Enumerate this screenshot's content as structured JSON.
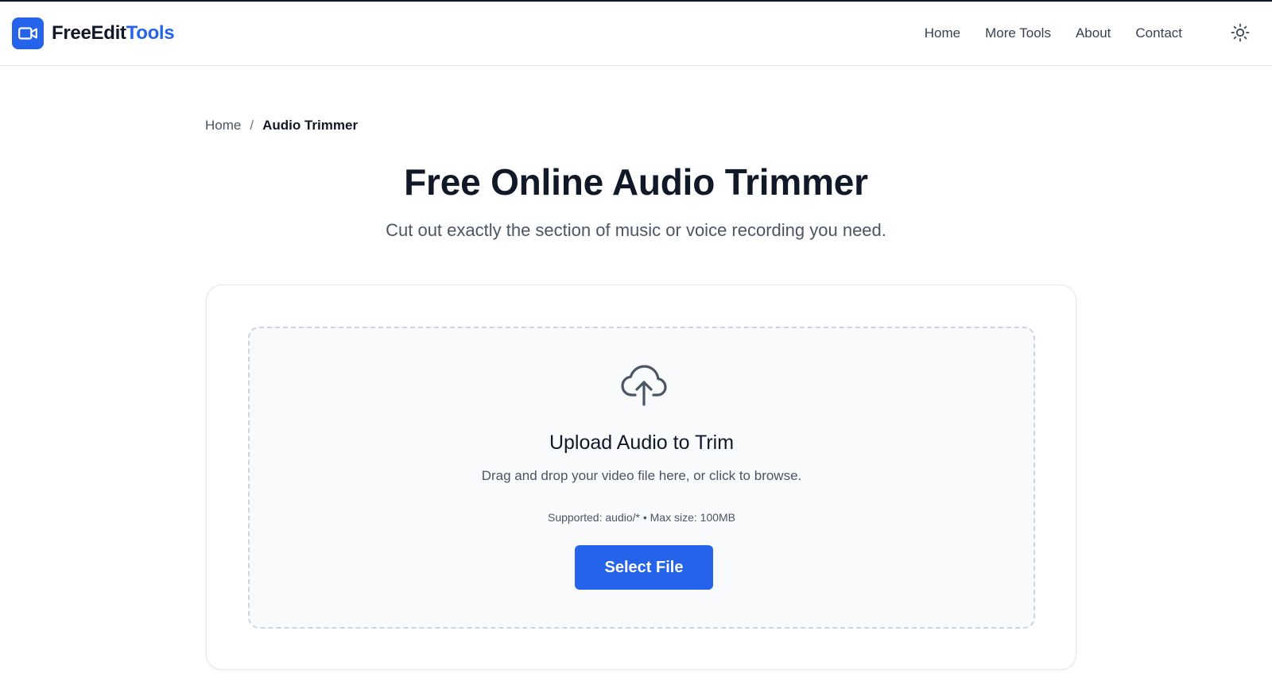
{
  "brand": {
    "name_part1": "FreeEdit",
    "name_part2": "Tools",
    "logo_icon": "video-camera-icon",
    "accent_color": "#2563eb"
  },
  "nav": {
    "items": [
      {
        "label": "Home"
      },
      {
        "label": "More Tools"
      },
      {
        "label": "About"
      },
      {
        "label": "Contact"
      }
    ],
    "theme_toggle_icon": "sun-icon"
  },
  "breadcrumb": {
    "home": "Home",
    "separator": "/",
    "current": "Audio Trimmer"
  },
  "page": {
    "title": "Free Online Audio Trimmer",
    "subtitle": "Cut out exactly the section of music or voice recording you need."
  },
  "upload": {
    "icon": "cloud-upload-icon",
    "title": "Upload Audio to Trim",
    "description": "Drag and drop your video file here, or click to browse.",
    "supported": "Supported: audio/* • Max size: 100MB",
    "button_label": "Select File"
  }
}
